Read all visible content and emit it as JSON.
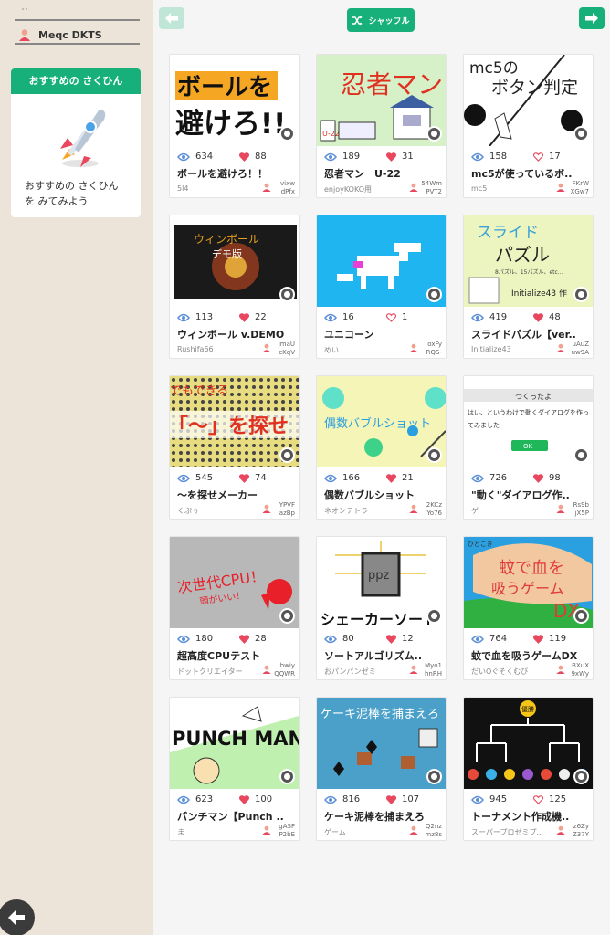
{
  "sidebar": {
    "top_label": "ﾟﾟ",
    "username": "Meqc DKTS",
    "reco_header": "おすすめの さくひん",
    "reco_line1": "おすすめの さくひん",
    "reco_line2": "を みてみよう"
  },
  "toolbar": {
    "shuffle_label": "シャッフル"
  },
  "colors": {
    "accent": "#17b07a",
    "sidebar_bg": "#ede4d9",
    "heart": "#e8475d",
    "eye": "#5b8fd8"
  },
  "cards": [
    {
      "views": "634",
      "likes": "88",
      "liked": true,
      "title": "ボールを避けろ！！",
      "author": "5l4",
      "code1": "vixw",
      "code2": "dPfx"
    },
    {
      "views": "189",
      "likes": "31",
      "liked": true,
      "title": "忍者マン　U-22",
      "author": "enjoyKOKO用",
      "code1": "54Wm",
      "code2": "PVT2"
    },
    {
      "views": "158",
      "likes": "17",
      "liked": false,
      "title": "mc5が使っているボ..",
      "author": "mc5",
      "code1": "FKrW",
      "code2": "XGw7"
    },
    {
      "views": "113",
      "likes": "22",
      "liked": true,
      "title": "ウィンボール v.DEMO",
      "author": "Rushifa66",
      "code1": "jmaU",
      "code2": "cKqV"
    },
    {
      "views": "16",
      "likes": "1",
      "liked": false,
      "title": "ユニコーン",
      "author": "めい",
      "code1": "oxFy",
      "code2": "RQS-"
    },
    {
      "views": "419",
      "likes": "48",
      "liked": true,
      "title": "スライドパズル【ver..",
      "author": "Initialize43",
      "code1": "uAuZ",
      "code2": "uw9A"
    },
    {
      "views": "545",
      "likes": "74",
      "liked": true,
      "title": "〜を探せメーカー",
      "author": "くぷぅ",
      "code1": "YPVF",
      "code2": "azBp"
    },
    {
      "views": "166",
      "likes": "21",
      "liked": true,
      "title": "偶数バブルショット",
      "author": "ネオンテトラ",
      "code1": "2KCz",
      "code2": "Yo76"
    },
    {
      "views": "726",
      "likes": "98",
      "liked": true,
      "title": "\"動く\"ダイアログ作..",
      "author": "ゲ",
      "code1": "Rs9b",
      "code2": "jX5P"
    },
    {
      "views": "180",
      "likes": "28",
      "liked": true,
      "title": "超高度CPUテスト",
      "author": "ドットクリエイター",
      "code1": "hwiy",
      "code2": "QQWR"
    },
    {
      "views": "80",
      "likes": "12",
      "liked": true,
      "title": "ソートアルゴリズム..",
      "author": "おパンパンゼミ",
      "code1": "Myo1",
      "code2": "hnRH"
    },
    {
      "views": "764",
      "likes": "119",
      "liked": true,
      "title": "蚊で血を吸うゲームDX",
      "author": "だいOぐそくむび",
      "code1": "BXuX",
      "code2": "9xWy"
    },
    {
      "views": "623",
      "likes": "100",
      "liked": true,
      "title": "パンチマン【Punch ..",
      "author": "ま",
      "code1": "gASF",
      "code2": "P2bE"
    },
    {
      "views": "816",
      "likes": "107",
      "liked": true,
      "title": "ケーキ泥棒を捕まえろ",
      "author": "ゲーム",
      "code1": "Q2nz",
      "code2": "mz8s"
    },
    {
      "views": "945",
      "likes": "125",
      "liked": false,
      "title": "トーナメント作成機..",
      "author": "スーパープロゼミプ..",
      "code1": "z6Zy",
      "code2": "Z37Y"
    }
  ],
  "thumbs": {
    "t0": {
      "line1": "ボールを",
      "line2": "避けろ!!"
    },
    "t1": {
      "title": "忍者マン",
      "badge": "U-22"
    },
    "t2": {
      "line1": "mc5の",
      "line2": "ボタン判定"
    },
    "t3": {
      "line1": "ウィンボール",
      "line2": "デモ版"
    },
    "t5": {
      "line1": "スライド",
      "line2": "パズル",
      "sub": "8パズル、15パズル、etc…",
      "credit": "Initialize43 作"
    },
    "t6": {
      "line1": "「〜」を探せ",
      "line0": "でもできる"
    },
    "t7": {
      "title": "偶数バブルショット"
    },
    "t8": {
      "header": "つくったよ",
      "body1": "はい、というわけで動くダイアログを作っ",
      "body2": "てみました",
      "ok": "OK"
    },
    "t9": {
      "line1": "次世代CPU！",
      "line2": "頭がいい！"
    },
    "t10": {
      "chip": "ppz",
      "caption": "シェーカーソート"
    },
    "t11": {
      "line1": "蚊で血を",
      "line2": "吸うゲーム",
      "dx": "DX",
      "corner": "ひとこき"
    },
    "t12": {
      "title": "PUNCH MAN"
    },
    "t13": {
      "title": "ケーキ泥棒を捕まえろ"
    },
    "t14": {
      "badge": "優勝"
    }
  }
}
